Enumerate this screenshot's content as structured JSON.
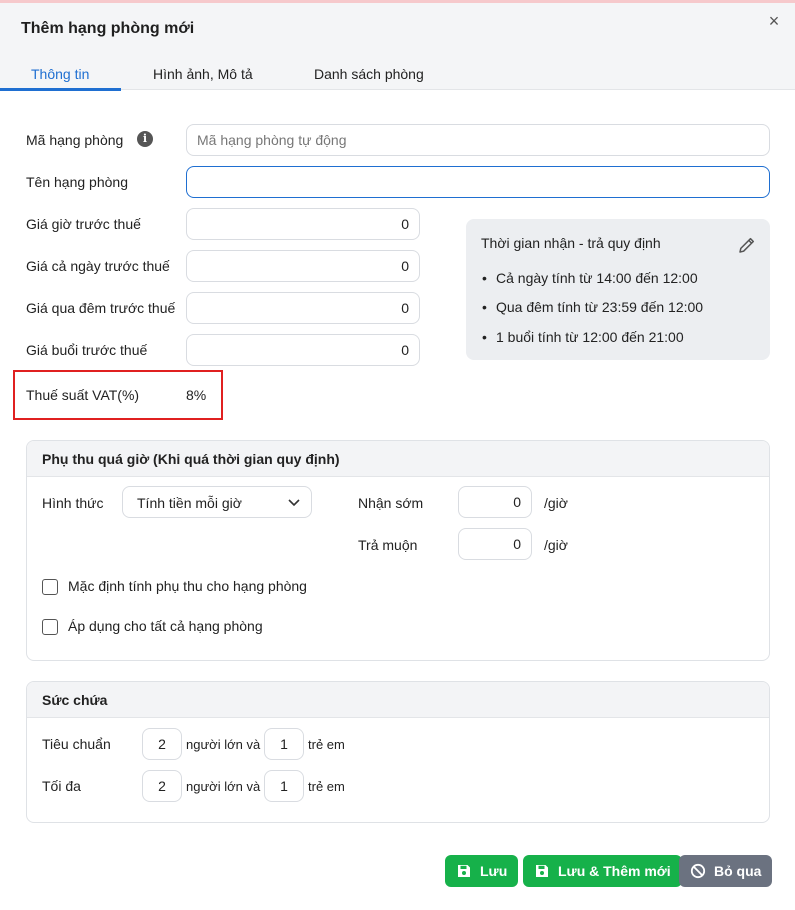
{
  "dialog": {
    "title": "Thêm hạng phòng mới",
    "close_glyph": "×"
  },
  "tabs": [
    {
      "label": "Thông tin",
      "active": true
    },
    {
      "label": "Hình ảnh, Mô tả",
      "active": false
    },
    {
      "label": "Danh sách phòng",
      "active": false
    }
  ],
  "form": {
    "code": {
      "label": "Mã hạng phòng",
      "placeholder": "Mã hạng phòng tự động",
      "value": "",
      "info_icon": "info-icon"
    },
    "name": {
      "label": "Tên hạng phòng",
      "value": ""
    },
    "hourly_price": {
      "label": "Giá giờ trước thuế",
      "value": "0"
    },
    "daily_price": {
      "label": "Giá cả ngày trước thuế",
      "value": "0"
    },
    "overnight_price": {
      "label": "Giá qua đêm trước thuế",
      "value": "0"
    },
    "session_price": {
      "label": "Giá buổi trước thuế",
      "value": "0"
    },
    "vat": {
      "label": "Thuế suất VAT(%)",
      "value": "8%"
    }
  },
  "time_rules": {
    "title": "Thời gian nhận - trả quy định",
    "edit_icon": "pencil-icon",
    "items": [
      "Cả ngày tính từ 14:00 đến 12:00",
      "Qua đêm tính từ 23:59 đến 12:00",
      "1 buổi tính từ 12:00 đến 21:00"
    ]
  },
  "surcharge": {
    "title": "Phụ thu quá giờ (Khi quá thời gian quy định)",
    "method_label": "Hình thức",
    "method_value": "Tính tiền mỗi giờ",
    "early_label": "Nhận sớm",
    "early_value": "0",
    "late_label": "Trả muộn",
    "late_value": "0",
    "unit": "/giờ",
    "checkbox_default": {
      "label": "Mặc định tính phụ thu cho hạng phòng",
      "checked": false
    },
    "checkbox_all": {
      "label": "Áp dụng cho tất cả hạng phòng",
      "checked": false
    }
  },
  "capacity": {
    "title": "Sức chứa",
    "standard": {
      "label": "Tiêu chuẩn",
      "adults": "2",
      "children": "1"
    },
    "max": {
      "label": "Tối đa",
      "adults": "2",
      "children": "1"
    },
    "adults_suffix": "người lớn và",
    "children_suffix": "trẻ em"
  },
  "buttons": {
    "save": "Lưu",
    "save_and_new": "Lưu & Thêm mới",
    "skip": "Bỏ qua"
  },
  "colors": {
    "accent": "#1f6fd1",
    "success": "#16b14a",
    "neutral": "#6b7280",
    "highlight": "#e02020"
  }
}
